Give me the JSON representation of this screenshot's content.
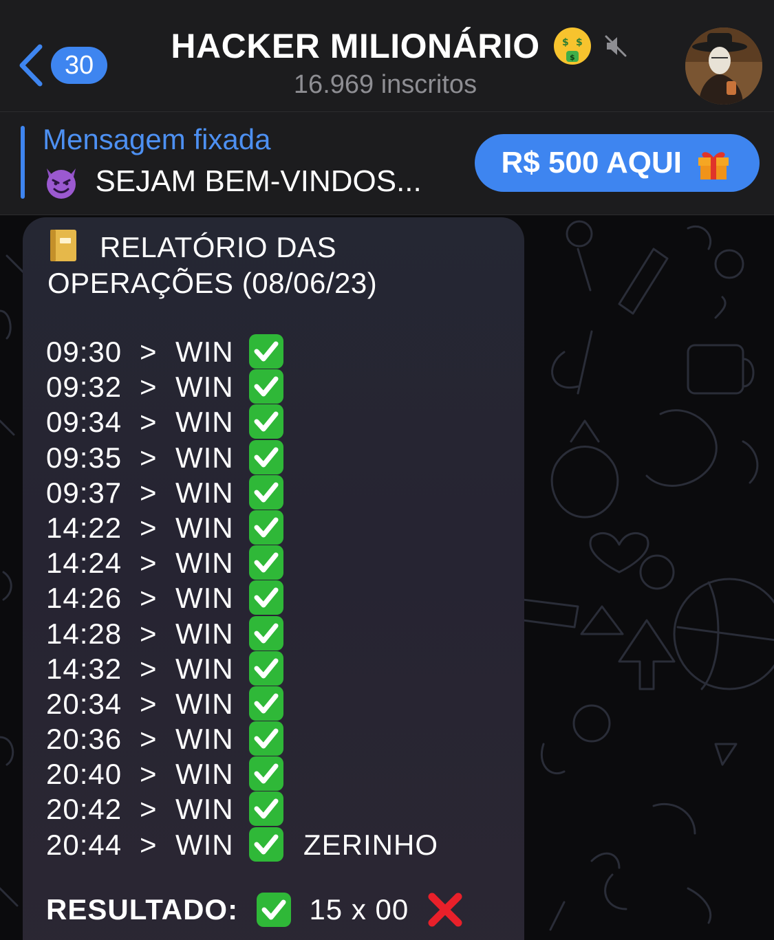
{
  "header": {
    "back_badge": "30",
    "title": "HACKER MILIONÁRIO",
    "subscribers": "16.969 inscritos",
    "title_emoji_icon": "money-mouth-face-icon",
    "mute_icon": "speaker-muted-icon"
  },
  "pinned": {
    "label": "Mensagem fixada",
    "text": "SEJAM BEM-VINDOS...",
    "text_icon": "smiling-devil-icon",
    "cta_label": "R$ 500 AQUI",
    "cta_icon": "gift-icon"
  },
  "message": {
    "title": "RELATÓRIO DAS OPERAÇÕES (08/06/23)",
    "title_icon": "ledger-book-icon",
    "operations": [
      {
        "time": "09:30",
        "arrow": ">",
        "result": "WIN",
        "note": ""
      },
      {
        "time": "09:32",
        "arrow": ">",
        "result": "WIN",
        "note": ""
      },
      {
        "time": "09:34",
        "arrow": ">",
        "result": "WIN",
        "note": ""
      },
      {
        "time": "09:35",
        "arrow": ">",
        "result": "WIN",
        "note": ""
      },
      {
        "time": "09:37",
        "arrow": ">",
        "result": "WIN",
        "note": ""
      },
      {
        "time": "14:22",
        "arrow": ">",
        "result": "WIN",
        "note": ""
      },
      {
        "time": "14:24",
        "arrow": ">",
        "result": "WIN",
        "note": ""
      },
      {
        "time": "14:26",
        "arrow": ">",
        "result": "WIN",
        "note": ""
      },
      {
        "time": "14:28",
        "arrow": ">",
        "result": "WIN",
        "note": ""
      },
      {
        "time": "14:32",
        "arrow": ">",
        "result": "WIN",
        "note": ""
      },
      {
        "time": "20:34",
        "arrow": ">",
        "result": "WIN",
        "note": ""
      },
      {
        "time": "20:36",
        "arrow": ">",
        "result": "WIN",
        "note": ""
      },
      {
        "time": "20:40",
        "arrow": ">",
        "result": "WIN",
        "note": ""
      },
      {
        "time": "20:42",
        "arrow": ">",
        "result": "WIN",
        "note": ""
      },
      {
        "time": "20:44",
        "arrow": ">",
        "result": "WIN",
        "note": "ZERINHO"
      }
    ],
    "result_label": "RESULTADO:",
    "result_score": "15 x 00",
    "check_icon": "green-check-mark-icon",
    "cross_icon": "red-cross-mark-icon"
  },
  "colors": {
    "accent": "#3e85f0",
    "header_bg": "#1c1c1e",
    "bubble_bg": "#262432",
    "check_green": "#2fb838",
    "cross_red": "#e8202a",
    "muted_text": "#8e8e93"
  }
}
